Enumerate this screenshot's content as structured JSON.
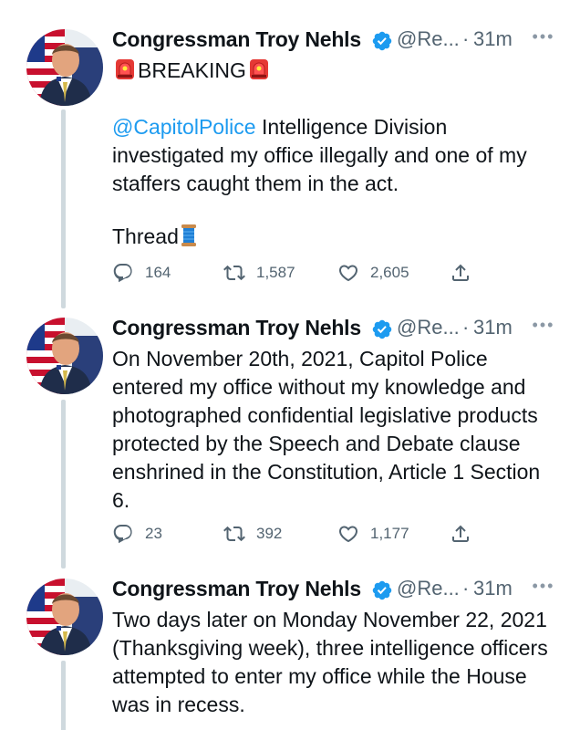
{
  "tweets": [
    {
      "author": "Congressman Troy Nehls",
      "handle": "@Re...",
      "separator": "·",
      "time": "31m",
      "breaking": "BREAKING",
      "mention": "@CapitolPolice",
      "text_after_mention": " Intelligence Division investigated my office illegally and one of my staffers caught them in the act.",
      "thread_label": "Thread",
      "replies": "164",
      "retweets": "1,587",
      "likes": "2,605"
    },
    {
      "author": "Congressman Troy Nehls",
      "handle": "@Re...",
      "separator": "·",
      "time": "31m",
      "text": "On November 20th, 2021, Capitol Police entered my office without my knowledge and photographed confidential legislative products protected by the Speech and Debate clause enshrined in the Constitution, Article 1 Section 6.",
      "replies": "23",
      "retweets": "392",
      "likes": "1,177"
    },
    {
      "author": "Congressman Troy Nehls",
      "handle": "@Re...",
      "separator": "·",
      "time": "31m",
      "text": "Two days later on Monday November 22, 2021 (Thanksgiving week), three intelligence officers attempted to enter my office while the House was in recess."
    }
  ],
  "icons": {
    "verified": "verified-badge-icon",
    "more": "more-options-icon",
    "reply": "reply-icon",
    "retweet": "retweet-icon",
    "like": "heart-icon",
    "share": "share-icon",
    "siren": "siren-emoji-icon",
    "spool": "thread-spool-emoji-icon"
  },
  "colors": {
    "link": "#1d9bf0",
    "secondary_text": "#536471",
    "thread_line": "#cfd9de"
  }
}
